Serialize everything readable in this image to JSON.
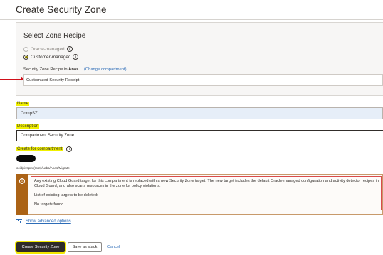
{
  "page": {
    "title": "Create Security Zone"
  },
  "recipe": {
    "section_title": "Select Zone Recipe",
    "option_oracle": "Oracle-managed",
    "option_customer": "Customer-managed",
    "selected": "Customer-managed",
    "recipe_in_label": "Security Zone Recipe in",
    "compartment": "Anas",
    "change_compartment": "(Change compartment)",
    "recipe_value": "Customized Security Receipt"
  },
  "name": {
    "label": "Name",
    "value": "CompSZ"
  },
  "description": {
    "label": "Description",
    "value": "Compartment Security Zone"
  },
  "compartment": {
    "label": "Create for compartment",
    "path": "ocidpivspm (root)/Labs/Anas/Migrate"
  },
  "warning": {
    "line1": "Any existing Cloud Guard target for this compartment is replaced with a new Security Zone target. The new target includes the default Oracle-managed configuration and activity",
    "line2": "detector recipes in Cloud Guard, and also scans resources in the zone for policy violations.",
    "list_label": "List of existing targets to be deleted:",
    "empty": "No targets found"
  },
  "advanced": {
    "label": "Show advanced options"
  },
  "buttons": {
    "create": "Create Security Zone",
    "save_stack": "Save as stack",
    "cancel": "Cancel"
  },
  "colors": {
    "highlight": "#f0f000",
    "primary_button": "#2e2b28",
    "link": "#2d6cb7",
    "warning_bar": "#ab6316",
    "annotation_red": "#d0101a"
  },
  "icons": {
    "info": "info-icon",
    "warning": "warning-icon",
    "advanced": "sliders-icon"
  }
}
